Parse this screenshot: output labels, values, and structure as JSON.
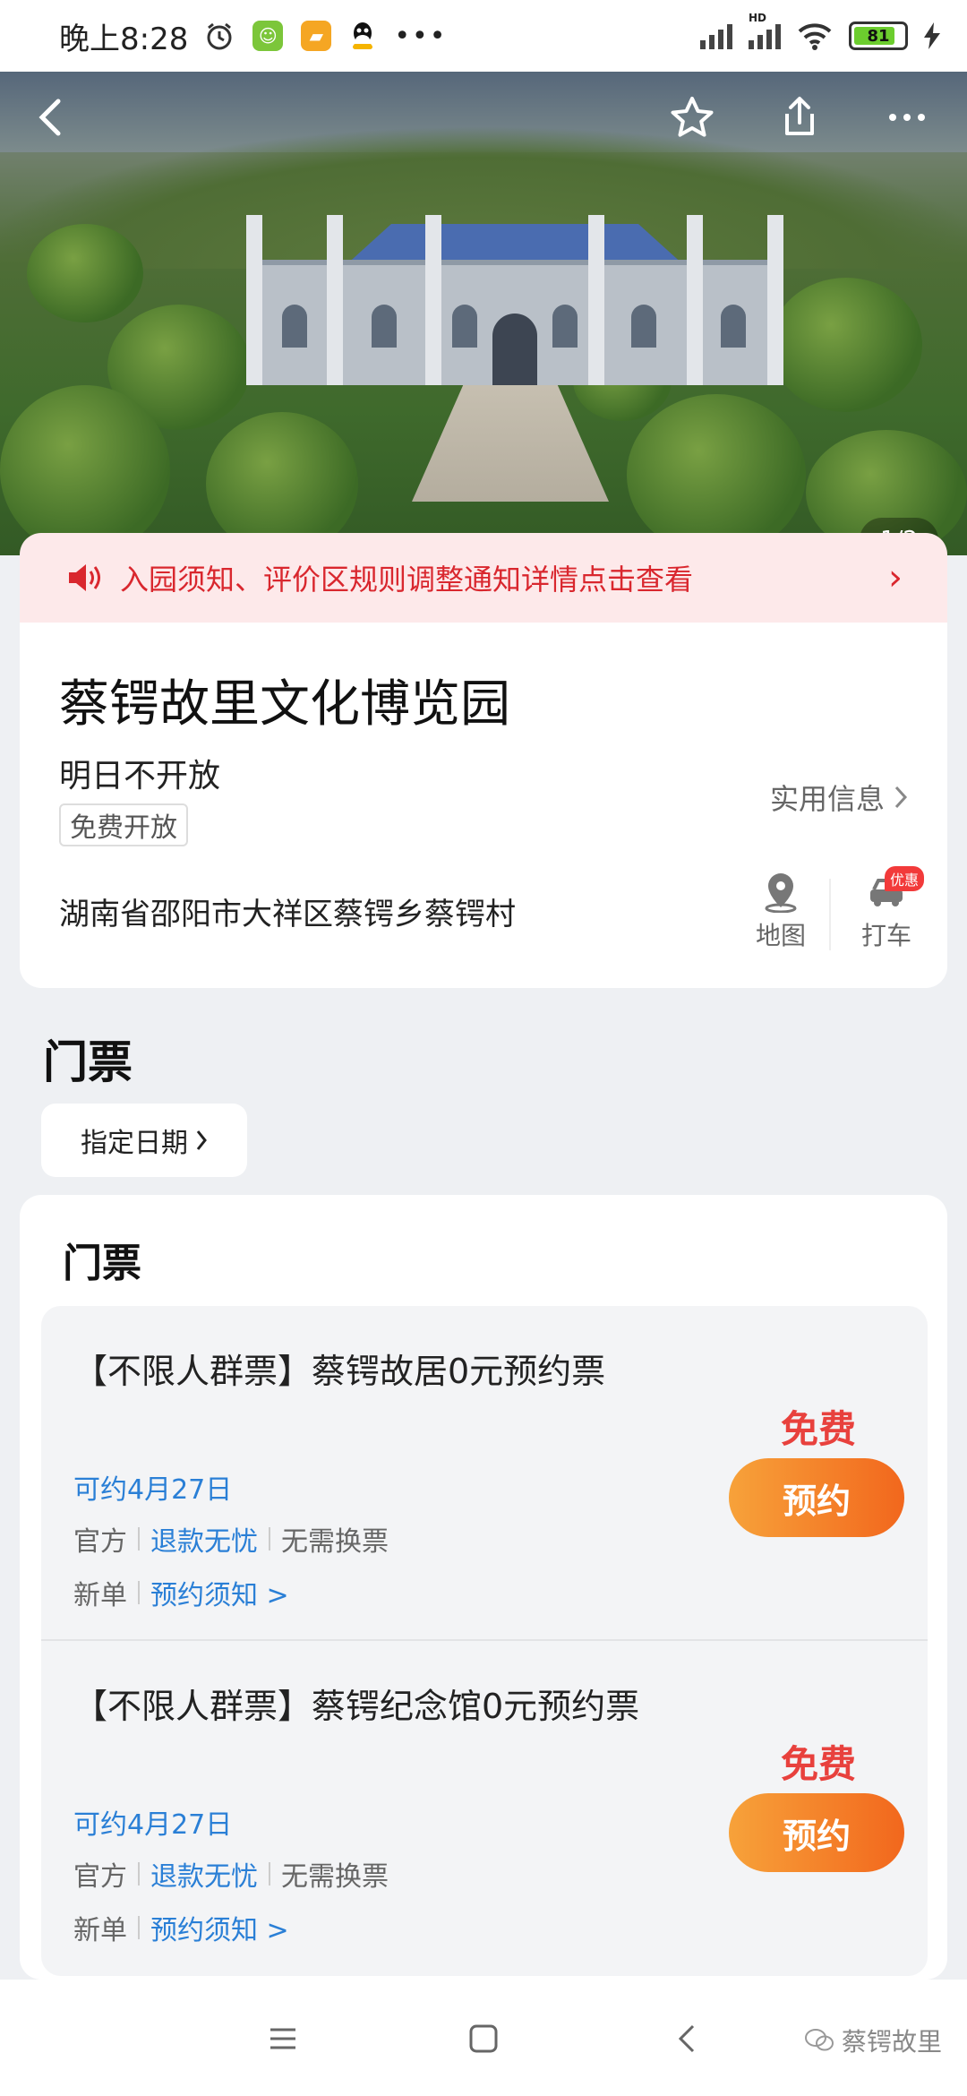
{
  "status_bar": {
    "time": "晚上8:28",
    "battery": "81",
    "network_label": "HD"
  },
  "hero": {
    "page_counter": "1/2",
    "icons": [
      "back-icon",
      "star-icon",
      "share-icon",
      "more-icon"
    ]
  },
  "notice": {
    "text": "入园须知、评价区规则调整通知详情点击查看"
  },
  "attraction": {
    "name": "蔡锷故里文化博览园",
    "open_status": "明日不开放",
    "tag": "免费开放",
    "practical_info": "实用信息",
    "address": "湖南省邵阳市大祥区蔡锷乡蔡锷村",
    "map_label": "地图",
    "taxi_label": "打车",
    "taxi_badge": "优惠"
  },
  "tickets_section": {
    "heading": "门票",
    "date_button": "指定日期",
    "card_title": "门票",
    "items": [
      {
        "name": "【不限人群票】蔡锷故居0元预约票",
        "available": "可约4月27日",
        "tag1": "官方",
        "tag2": "退款无忧",
        "tag3": "无需换票",
        "tag4": "新单",
        "notice_link": "预约须知 >",
        "price": "免费",
        "book_label": "预约"
      },
      {
        "name": "【不限人群票】蔡锷纪念馆0元预约票",
        "available": "可约4月27日",
        "tag1": "官方",
        "tag2": "退款无忧",
        "tag3": "无需换票",
        "tag4": "新单",
        "notice_link": "预约须知 >",
        "price": "免费",
        "book_label": "预约"
      }
    ]
  },
  "watermark": "蔡锷故里",
  "colors": {
    "accent_red": "#e8413d",
    "link_blue": "#2a7fd6",
    "button_orange": "#f2671d",
    "notice_bg": "#fde9ea"
  }
}
